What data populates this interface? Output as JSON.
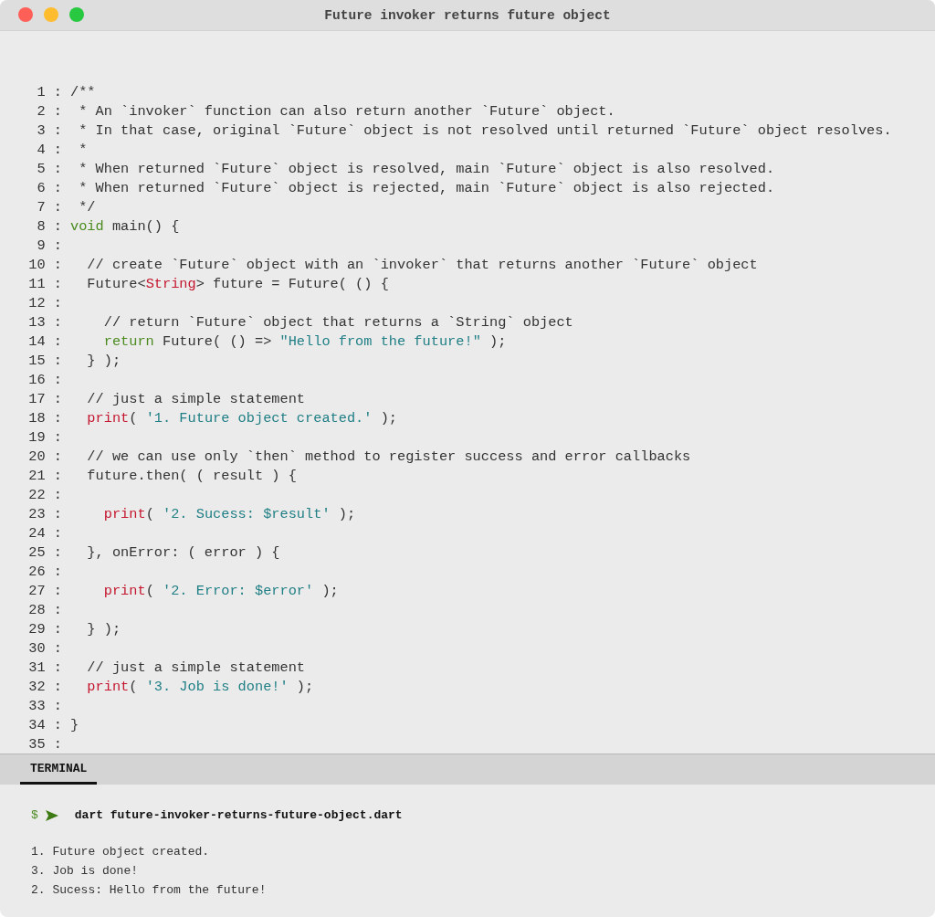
{
  "window": {
    "title": "Future invoker returns future object"
  },
  "code": [
    {
      "gutter": "1 :",
      "tokens": [
        {
          "kind": "plain",
          "text": "/**"
        }
      ]
    },
    {
      "gutter": "2 :",
      "tokens": [
        {
          "kind": "plain",
          "text": " * An `invoker` function can also return another `Future` object."
        }
      ]
    },
    {
      "gutter": "3 :",
      "tokens": [
        {
          "kind": "plain",
          "text": " * In that case, original `Future` object is not resolved until returned `Future` object resolves."
        }
      ]
    },
    {
      "gutter": "4 :",
      "tokens": [
        {
          "kind": "plain",
          "text": " *"
        }
      ]
    },
    {
      "gutter": "5 :",
      "tokens": [
        {
          "kind": "plain",
          "text": " * When returned `Future` object is resolved, main `Future` object is also resolved."
        }
      ]
    },
    {
      "gutter": "6 :",
      "tokens": [
        {
          "kind": "plain",
          "text": " * When returned `Future` object is rejected, main `Future` object is also rejected."
        }
      ]
    },
    {
      "gutter": "7 :",
      "tokens": [
        {
          "kind": "plain",
          "text": " */"
        }
      ]
    },
    {
      "gutter": "8 :",
      "tokens": [
        {
          "kind": "keyword",
          "text": "void"
        },
        {
          "kind": "plain",
          "text": " main() {"
        }
      ]
    },
    {
      "gutter": "9 :"
    },
    {
      "gutter": "10 :",
      "tokens": [
        {
          "kind": "plain",
          "text": "  // create `Future` object with an `invoker` that returns another `Future` object"
        }
      ]
    },
    {
      "gutter": "11 :",
      "tokens": [
        {
          "kind": "plain",
          "text": "  Future<"
        },
        {
          "kind": "builtin",
          "text": "String"
        },
        {
          "kind": "plain",
          "text": "> future = Future( () {"
        }
      ]
    },
    {
      "gutter": "12 :"
    },
    {
      "gutter": "13 :",
      "tokens": [
        {
          "kind": "plain",
          "text": "    // return `Future` object that returns a `String` object"
        }
      ]
    },
    {
      "gutter": "14 :",
      "tokens": [
        {
          "kind": "keyword",
          "text": "    return"
        },
        {
          "kind": "plain",
          "text": " Future( () => "
        },
        {
          "kind": "string",
          "text": "\"Hello from the future!\""
        },
        {
          "kind": "plain",
          "text": " );"
        }
      ]
    },
    {
      "gutter": "15 :",
      "tokens": [
        {
          "kind": "plain",
          "text": "  } );"
        }
      ]
    },
    {
      "gutter": "16 :"
    },
    {
      "gutter": "17 :",
      "tokens": [
        {
          "kind": "plain",
          "text": "  // just a simple statement"
        }
      ]
    },
    {
      "gutter": "18 :",
      "tokens": [
        {
          "kind": "builtin",
          "text": "  print"
        },
        {
          "kind": "plain",
          "text": "( "
        },
        {
          "kind": "string",
          "text": "'1. Future object created.'"
        },
        {
          "kind": "plain",
          "text": " );"
        }
      ]
    },
    {
      "gutter": "19 :"
    },
    {
      "gutter": "20 :",
      "tokens": [
        {
          "kind": "plain",
          "text": "  // we can use only `then` method to register success and error callbacks"
        }
      ]
    },
    {
      "gutter": "21 :",
      "tokens": [
        {
          "kind": "plain",
          "text": "  future.then( ( result ) {"
        }
      ]
    },
    {
      "gutter": "22 :"
    },
    {
      "gutter": "23 :",
      "tokens": [
        {
          "kind": "builtin",
          "text": "    print"
        },
        {
          "kind": "plain",
          "text": "( "
        },
        {
          "kind": "string",
          "text": "'2. Sucess: $result'"
        },
        {
          "kind": "plain",
          "text": " );"
        }
      ]
    },
    {
      "gutter": "24 :"
    },
    {
      "gutter": "25 :",
      "tokens": [
        {
          "kind": "plain",
          "text": "  }, onError: ( error ) {"
        }
      ]
    },
    {
      "gutter": "26 :"
    },
    {
      "gutter": "27 :",
      "tokens": [
        {
          "kind": "builtin",
          "text": "    print"
        },
        {
          "kind": "plain",
          "text": "( "
        },
        {
          "kind": "string",
          "text": "'2. Error: $error'"
        },
        {
          "kind": "plain",
          "text": " );"
        }
      ]
    },
    {
      "gutter": "28 :"
    },
    {
      "gutter": "29 :",
      "tokens": [
        {
          "kind": "plain",
          "text": "  } );"
        }
      ]
    },
    {
      "gutter": "30 :"
    },
    {
      "gutter": "31 :",
      "tokens": [
        {
          "kind": "plain",
          "text": "  // just a simple statement"
        }
      ]
    },
    {
      "gutter": "32 :",
      "tokens": [
        {
          "kind": "builtin",
          "text": "  print"
        },
        {
          "kind": "plain",
          "text": "( "
        },
        {
          "kind": "string",
          "text": "'3. Job is done!'"
        },
        {
          "kind": "plain",
          "text": " );"
        }
      ]
    },
    {
      "gutter": "33 :"
    },
    {
      "gutter": "34 :",
      "tokens": [
        {
          "kind": "plain",
          "text": "}"
        }
      ]
    },
    {
      "gutter": "35 :"
    }
  ],
  "terminal": {
    "tabs": [
      {
        "label": "TERMINAL",
        "selected": true
      }
    ],
    "prompt": "$",
    "command": "dart future-invoker-returns-future-object.dart",
    "output": [
      "1. Future object created.",
      "3. Job is done!",
      "2. Sucess: Hello from the future!"
    ]
  }
}
